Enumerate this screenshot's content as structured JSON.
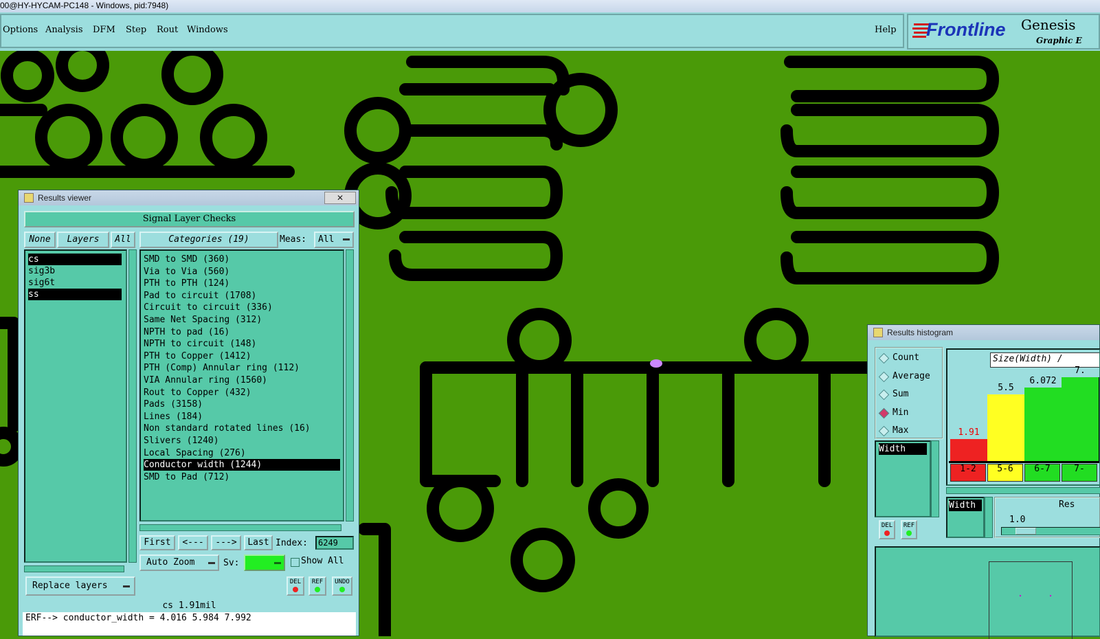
{
  "window_title": "00@HY-HYCAM-PC148 - Windows, pid:7948)",
  "menu": {
    "items": [
      "Options",
      "Analysis",
      "DFM",
      "Step",
      "Rout",
      "Windows"
    ],
    "help": "Help"
  },
  "logo": {
    "brand": "Frontline",
    "product": "Genesis",
    "subtitle": "Graphic E"
  },
  "results_viewer": {
    "title": "Results viewer",
    "close": "✕",
    "header": "Signal Layer Checks",
    "none_btn": "None",
    "layers_btn": "Layers",
    "all_btn": "All",
    "layers": [
      {
        "name": "cs",
        "selected": true
      },
      {
        "name": "sig3b",
        "selected": false
      },
      {
        "name": "sig6t",
        "selected": false
      },
      {
        "name": "ss",
        "selected": true
      }
    ],
    "categories_btn": "Categories (19)",
    "meas_label": "Meas:",
    "meas_value": "All",
    "categories": [
      {
        "label": "SMD to SMD (360)",
        "selected": false
      },
      {
        "label": "Via to Via (560)",
        "selected": false
      },
      {
        "label": "PTH to PTH (124)",
        "selected": false
      },
      {
        "label": "Pad to circuit (1708)",
        "selected": false
      },
      {
        "label": "Circuit to circuit (336)",
        "selected": false
      },
      {
        "label": "Same Net Spacing (312)",
        "selected": false
      },
      {
        "label": "NPTH to pad (16)",
        "selected": false
      },
      {
        "label": "NPTH to circuit (148)",
        "selected": false
      },
      {
        "label": "PTH to Copper (1412)",
        "selected": false
      },
      {
        "label": "PTH (Comp) Annular ring (112)",
        "selected": false
      },
      {
        "label": "VIA Annular ring (1560)",
        "selected": false
      },
      {
        "label": "Rout to Copper (432)",
        "selected": false
      },
      {
        "label": "Pads (3158)",
        "selected": false
      },
      {
        "label": "Lines (184)",
        "selected": false
      },
      {
        "label": "Non standard rotated lines (16)",
        "selected": false
      },
      {
        "label": "Slivers (1240)",
        "selected": false
      },
      {
        "label": "Local Spacing (276)",
        "selected": false
      },
      {
        "label": "Conductor width (1244)",
        "selected": true
      },
      {
        "label": "SMD to Pad (712)",
        "selected": false
      }
    ],
    "first": "First",
    "prev": "<---",
    "next": "--->",
    "last": "Last",
    "index_label": "Index:",
    "index_value": "6249",
    "auto_zoom": "Auto Zoom",
    "sv_label": "Sv:",
    "show_all": "Show All",
    "replace_layers": "Replace layers",
    "del": "DEL",
    "ref": "REF",
    "undo": "UNDO",
    "status1": "cs 1.91mil",
    "status2": "ERF--> conductor_width = 4.016 5.984 7.992"
  },
  "histogram": {
    "title": "Results histogram",
    "options": [
      {
        "label": "Count",
        "selected": false
      },
      {
        "label": "Average",
        "selected": false
      },
      {
        "label": "Sum",
        "selected": false
      },
      {
        "label": "Min",
        "selected": true
      },
      {
        "label": "Max",
        "selected": false
      }
    ],
    "field": "Width",
    "field2": "Width",
    "size_label": "Size(Width) / ",
    "res_label": "Res",
    "res_value": "1.0",
    "del": "DEL",
    "ref": "REF",
    "colors": {
      "red": "#ee2222",
      "yellow": "#ffff22",
      "green": "#22dd22"
    }
  },
  "chart_data": {
    "type": "bar",
    "categories": [
      "1-2",
      "5-6",
      "6-7",
      "7-"
    ],
    "values": [
      1.91,
      5.5,
      6.072,
      7.0
    ],
    "value_labels": [
      "1.91",
      "5.5",
      "6.072",
      "7."
    ],
    "colors": [
      "#ee2222",
      "#ffff22",
      "#22dd22",
      "#22dd22"
    ]
  }
}
